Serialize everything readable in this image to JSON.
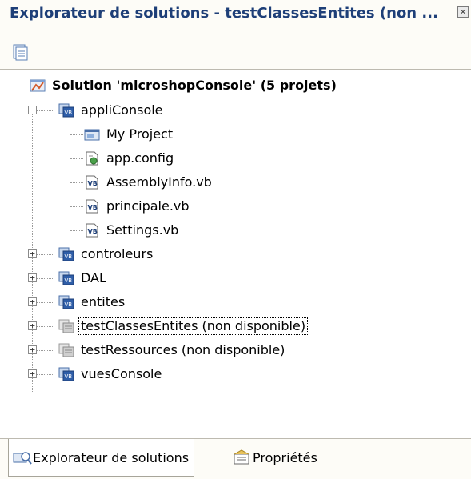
{
  "window": {
    "title": "Explorateur de solutions - testClassesEntites (non ...",
    "close_icon": "close-icon"
  },
  "toolbar": {
    "properties_icon": "properties-icon"
  },
  "tree": {
    "solution_label": "Solution 'microshopConsole' (5 projets)",
    "items": [
      {
        "label": "appliConsole",
        "icon": "vb-project-icon",
        "expanded": true
      },
      {
        "label": "My Project",
        "icon": "my-project-icon"
      },
      {
        "label": "app.config",
        "icon": "config-file-icon"
      },
      {
        "label": "AssemblyInfo.vb",
        "icon": "vb-file-icon"
      },
      {
        "label": "principale.vb",
        "icon": "vb-file-icon"
      },
      {
        "label": "Settings.vb",
        "icon": "vb-file-icon"
      },
      {
        "label": "controleurs",
        "icon": "vb-project-icon",
        "expanded": false
      },
      {
        "label": "DAL",
        "icon": "vb-project-icon",
        "expanded": false
      },
      {
        "label": "entites",
        "icon": "vb-project-icon",
        "expanded": false
      },
      {
        "label": "testClassesEntites (non disponible)",
        "icon": "unavailable-project-icon",
        "expanded": false,
        "selected": true
      },
      {
        "label": "testRessources (non disponible)",
        "icon": "unavailable-project-icon",
        "expanded": false
      },
      {
        "label": "vuesConsole",
        "icon": "vb-project-icon",
        "expanded": false
      }
    ]
  },
  "tabs": [
    {
      "label": "Explorateur de solutions",
      "icon": "solution-explorer-icon",
      "active": true
    },
    {
      "label": "Propriétés",
      "icon": "properties-tab-icon",
      "active": false
    }
  ]
}
